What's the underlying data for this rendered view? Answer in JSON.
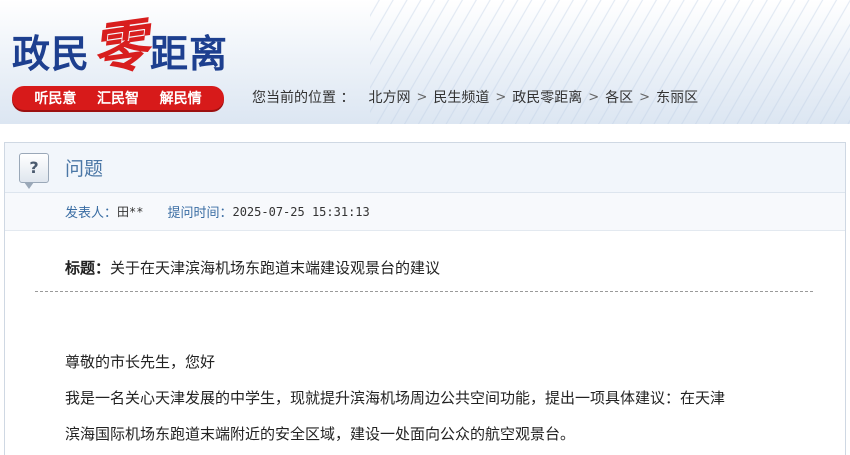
{
  "header": {
    "logo_part1": "政民",
    "logo_part2": "零",
    "logo_part3": "距离",
    "slogans": [
      "听民意",
      "汇民智",
      "解民情"
    ]
  },
  "breadcrumb": {
    "label": "您当前的位置 ：",
    "items": [
      "北方网",
      "民生频道",
      "政民零距离",
      "各区",
      "东丽区"
    ],
    "separator": ">"
  },
  "panel": {
    "title": "问题",
    "icon": "question-icon",
    "meta": {
      "author_label": "发表人：",
      "author_value": "田**",
      "time_label": "提问时间：",
      "time_value": "2025-07-25 15:31:13"
    },
    "subject_label": "标题：",
    "subject_value": "关于在天津滨海机场东跑道末端建设观景台的建议",
    "body": [
      "尊敬的市长先生，您好",
      "我是一名关心天津发展的中学生，现就提升滨海机场周边公共空间功能，提出一项具体建议：在天津",
      "滨海国际机场东跑道末端附近的安全区域，建设一处面向公众的航空观景台。"
    ]
  },
  "colors": {
    "logo_blue": "#1d3f8f",
    "logo_red": "#d81e1e",
    "slogan_bg": "#d71a1a",
    "accent_blue": "#3a6da3"
  }
}
